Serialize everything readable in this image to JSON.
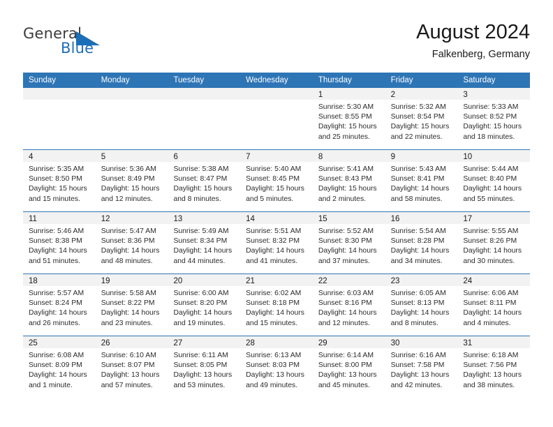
{
  "brand": {
    "name_part1": "General",
    "name_part2": "Blue",
    "flag_icon": "brand-flag-icon",
    "accent_color": "#1a6fb8"
  },
  "header": {
    "title": "August 2024",
    "location": "Falkenberg, Germany"
  },
  "theme": {
    "header_bg": "#2e75b6",
    "header_text": "#ffffff",
    "daynum_band_bg": "#f2f2f2",
    "cell_bg": "#ffffff",
    "separator": "#2e75b6"
  },
  "calendar": {
    "weekday_headers": [
      "Sunday",
      "Monday",
      "Tuesday",
      "Wednesday",
      "Thursday",
      "Friday",
      "Saturday"
    ],
    "weeks": [
      [
        {
          "day": "",
          "lines": []
        },
        {
          "day": "",
          "lines": []
        },
        {
          "day": "",
          "lines": []
        },
        {
          "day": "",
          "lines": []
        },
        {
          "day": "1",
          "lines": [
            "Sunrise: 5:30 AM",
            "Sunset: 8:55 PM",
            "Daylight: 15 hours",
            "and 25 minutes."
          ]
        },
        {
          "day": "2",
          "lines": [
            "Sunrise: 5:32 AM",
            "Sunset: 8:54 PM",
            "Daylight: 15 hours",
            "and 22 minutes."
          ]
        },
        {
          "day": "3",
          "lines": [
            "Sunrise: 5:33 AM",
            "Sunset: 8:52 PM",
            "Daylight: 15 hours",
            "and 18 minutes."
          ]
        }
      ],
      [
        {
          "day": "4",
          "lines": [
            "Sunrise: 5:35 AM",
            "Sunset: 8:50 PM",
            "Daylight: 15 hours",
            "and 15 minutes."
          ]
        },
        {
          "day": "5",
          "lines": [
            "Sunrise: 5:36 AM",
            "Sunset: 8:49 PM",
            "Daylight: 15 hours",
            "and 12 minutes."
          ]
        },
        {
          "day": "6",
          "lines": [
            "Sunrise: 5:38 AM",
            "Sunset: 8:47 PM",
            "Daylight: 15 hours",
            "and 8 minutes."
          ]
        },
        {
          "day": "7",
          "lines": [
            "Sunrise: 5:40 AM",
            "Sunset: 8:45 PM",
            "Daylight: 15 hours",
            "and 5 minutes."
          ]
        },
        {
          "day": "8",
          "lines": [
            "Sunrise: 5:41 AM",
            "Sunset: 8:43 PM",
            "Daylight: 15 hours",
            "and 2 minutes."
          ]
        },
        {
          "day": "9",
          "lines": [
            "Sunrise: 5:43 AM",
            "Sunset: 8:41 PM",
            "Daylight: 14 hours",
            "and 58 minutes."
          ]
        },
        {
          "day": "10",
          "lines": [
            "Sunrise: 5:44 AM",
            "Sunset: 8:40 PM",
            "Daylight: 14 hours",
            "and 55 minutes."
          ]
        }
      ],
      [
        {
          "day": "11",
          "lines": [
            "Sunrise: 5:46 AM",
            "Sunset: 8:38 PM",
            "Daylight: 14 hours",
            "and 51 minutes."
          ]
        },
        {
          "day": "12",
          "lines": [
            "Sunrise: 5:47 AM",
            "Sunset: 8:36 PM",
            "Daylight: 14 hours",
            "and 48 minutes."
          ]
        },
        {
          "day": "13",
          "lines": [
            "Sunrise: 5:49 AM",
            "Sunset: 8:34 PM",
            "Daylight: 14 hours",
            "and 44 minutes."
          ]
        },
        {
          "day": "14",
          "lines": [
            "Sunrise: 5:51 AM",
            "Sunset: 8:32 PM",
            "Daylight: 14 hours",
            "and 41 minutes."
          ]
        },
        {
          "day": "15",
          "lines": [
            "Sunrise: 5:52 AM",
            "Sunset: 8:30 PM",
            "Daylight: 14 hours",
            "and 37 minutes."
          ]
        },
        {
          "day": "16",
          "lines": [
            "Sunrise: 5:54 AM",
            "Sunset: 8:28 PM",
            "Daylight: 14 hours",
            "and 34 minutes."
          ]
        },
        {
          "day": "17",
          "lines": [
            "Sunrise: 5:55 AM",
            "Sunset: 8:26 PM",
            "Daylight: 14 hours",
            "and 30 minutes."
          ]
        }
      ],
      [
        {
          "day": "18",
          "lines": [
            "Sunrise: 5:57 AM",
            "Sunset: 8:24 PM",
            "Daylight: 14 hours",
            "and 26 minutes."
          ]
        },
        {
          "day": "19",
          "lines": [
            "Sunrise: 5:58 AM",
            "Sunset: 8:22 PM",
            "Daylight: 14 hours",
            "and 23 minutes."
          ]
        },
        {
          "day": "20",
          "lines": [
            "Sunrise: 6:00 AM",
            "Sunset: 8:20 PM",
            "Daylight: 14 hours",
            "and 19 minutes."
          ]
        },
        {
          "day": "21",
          "lines": [
            "Sunrise: 6:02 AM",
            "Sunset: 8:18 PM",
            "Daylight: 14 hours",
            "and 15 minutes."
          ]
        },
        {
          "day": "22",
          "lines": [
            "Sunrise: 6:03 AM",
            "Sunset: 8:16 PM",
            "Daylight: 14 hours",
            "and 12 minutes."
          ]
        },
        {
          "day": "23",
          "lines": [
            "Sunrise: 6:05 AM",
            "Sunset: 8:13 PM",
            "Daylight: 14 hours",
            "and 8 minutes."
          ]
        },
        {
          "day": "24",
          "lines": [
            "Sunrise: 6:06 AM",
            "Sunset: 8:11 PM",
            "Daylight: 14 hours",
            "and 4 minutes."
          ]
        }
      ],
      [
        {
          "day": "25",
          "lines": [
            "Sunrise: 6:08 AM",
            "Sunset: 8:09 PM",
            "Daylight: 14 hours",
            "and 1 minute."
          ]
        },
        {
          "day": "26",
          "lines": [
            "Sunrise: 6:10 AM",
            "Sunset: 8:07 PM",
            "Daylight: 13 hours",
            "and 57 minutes."
          ]
        },
        {
          "day": "27",
          "lines": [
            "Sunrise: 6:11 AM",
            "Sunset: 8:05 PM",
            "Daylight: 13 hours",
            "and 53 minutes."
          ]
        },
        {
          "day": "28",
          "lines": [
            "Sunrise: 6:13 AM",
            "Sunset: 8:03 PM",
            "Daylight: 13 hours",
            "and 49 minutes."
          ]
        },
        {
          "day": "29",
          "lines": [
            "Sunrise: 6:14 AM",
            "Sunset: 8:00 PM",
            "Daylight: 13 hours",
            "and 45 minutes."
          ]
        },
        {
          "day": "30",
          "lines": [
            "Sunrise: 6:16 AM",
            "Sunset: 7:58 PM",
            "Daylight: 13 hours",
            "and 42 minutes."
          ]
        },
        {
          "day": "31",
          "lines": [
            "Sunrise: 6:18 AM",
            "Sunset: 7:56 PM",
            "Daylight: 13 hours",
            "and 38 minutes."
          ]
        }
      ]
    ]
  }
}
